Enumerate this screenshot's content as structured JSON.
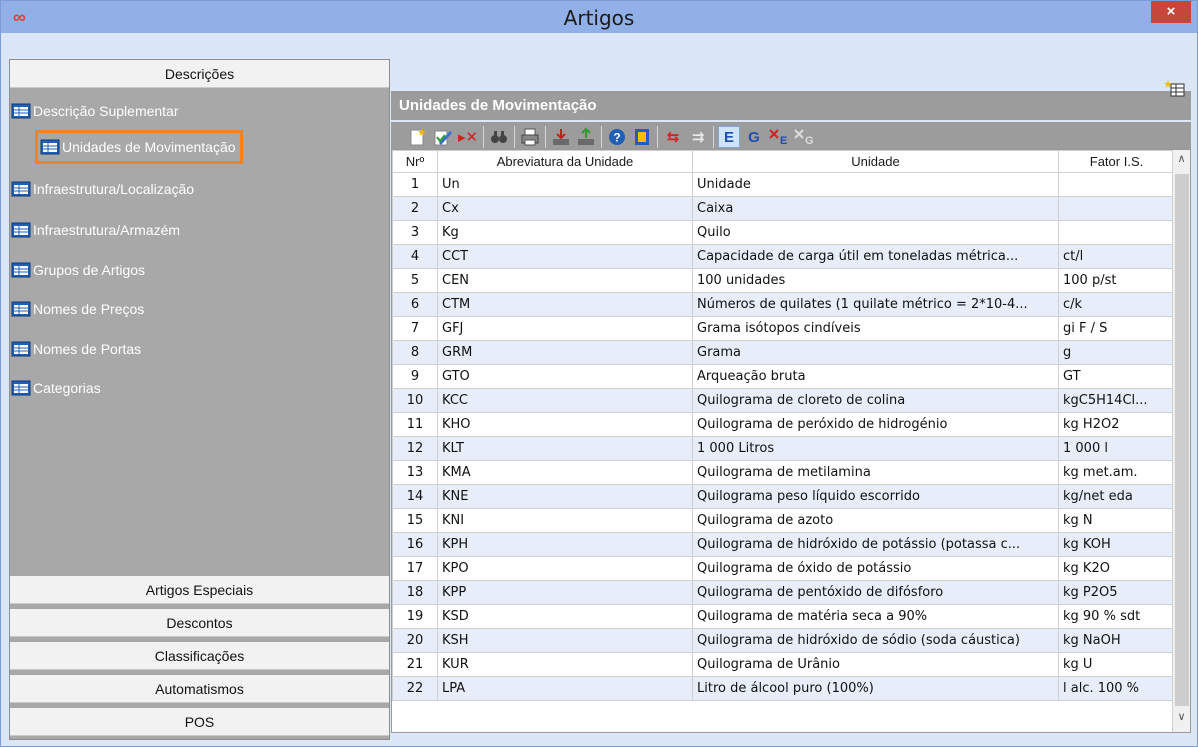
{
  "window": {
    "title": "Artigos",
    "close_glyph": "×",
    "app_icon": "infinity-logo-icon"
  },
  "sidebar": {
    "top_header": "Descrições",
    "items": [
      {
        "label": "Descrição Suplementar",
        "icon": "table-icon"
      },
      {
        "label": "Unidades de Movimentação",
        "icon": "table-icon",
        "selected": true
      },
      {
        "label": "Infraestrutura/Localização",
        "icon": "table-icon"
      },
      {
        "label": "Infraestrutura/Armazém",
        "icon": "table-icon"
      },
      {
        "label": "Grupos de Artigos",
        "icon": "table-icon"
      },
      {
        "label": "Nomes de Preços",
        "icon": "table-icon"
      },
      {
        "label": "Nomes de Portas",
        "icon": "table-icon"
      },
      {
        "label": "Categorias",
        "icon": "table-icon"
      }
    ],
    "bottom_sections": [
      "Artigos Especiais",
      "Descontos",
      "Classificações",
      "Automatismos",
      "POS"
    ]
  },
  "panel": {
    "title": "Unidades de Movimentação",
    "toolbar_letters": {
      "e": "E",
      "g": "G"
    }
  },
  "table": {
    "columns": [
      "Nrº",
      "Abreviatura da Unidade",
      "Unidade",
      "Fator I.S."
    ],
    "rows": [
      [
        "1",
        "Un",
        "Unidade",
        ""
      ],
      [
        "2",
        "Cx",
        "Caixa",
        ""
      ],
      [
        "3",
        "Kg",
        "Quilo",
        ""
      ],
      [
        "4",
        "CCT",
        "Capacidade de carga útil em toneladas métrica...",
        "ct/l"
      ],
      [
        "5",
        "CEN",
        "100 unidades",
        "100 p/st"
      ],
      [
        "6",
        "CTM",
        "Números de quilates (1 quilate métrico = 2*10-4...",
        "c/k"
      ],
      [
        "7",
        "GFJ",
        "Grama isótopos cindíveis",
        "gi F / S"
      ],
      [
        "8",
        "GRM",
        "Grama",
        "g"
      ],
      [
        "9",
        "GTO",
        "Arqueação bruta",
        "GT"
      ],
      [
        "10",
        "KCC",
        "Quilograma de cloreto de colina",
        "kgC5H14Cl..."
      ],
      [
        "11",
        "KHO",
        "Quilograma de peróxido de hidrogénio",
        "kg H2O2"
      ],
      [
        "12",
        "KLT",
        "1 000 Litros",
        "1 000 l"
      ],
      [
        "13",
        "KMA",
        "Quilograma de metilamina",
        "kg met.am."
      ],
      [
        "14",
        "KNE",
        "Quilograma peso líquido escorrido",
        "kg/net eda"
      ],
      [
        "15",
        "KNI",
        "Quilograma de azoto",
        "kg N"
      ],
      [
        "16",
        "KPH",
        "Quilograma de hidróxido de potássio (potassa c...",
        "kg KOH"
      ],
      [
        "17",
        "KPO",
        "Quilograma de óxido de potássio",
        "kg K2O"
      ],
      [
        "18",
        "KPP",
        "Quilograma de pentóxido de difósforo",
        "kg P2O5"
      ],
      [
        "19",
        "KSD",
        "Quilograma de matéria seca a 90%",
        "kg 90 % sdt"
      ],
      [
        "20",
        "KSH",
        "Quilograma de hidróxido de sódio (soda cáustica)",
        "kg NaOH"
      ],
      [
        "21",
        "KUR",
        "Quilograma de Urânio",
        "kg U"
      ],
      [
        "22",
        "LPA",
        "Litro de álcool puro (100%)",
        "l alc. 100 %"
      ]
    ]
  },
  "colors": {
    "titlebar": "#92b0e8",
    "sidebar_bg": "#a8a8a8",
    "selected_outline": "#f58220",
    "close_button": "#c7463c",
    "row_alt": "#e7eefa"
  }
}
